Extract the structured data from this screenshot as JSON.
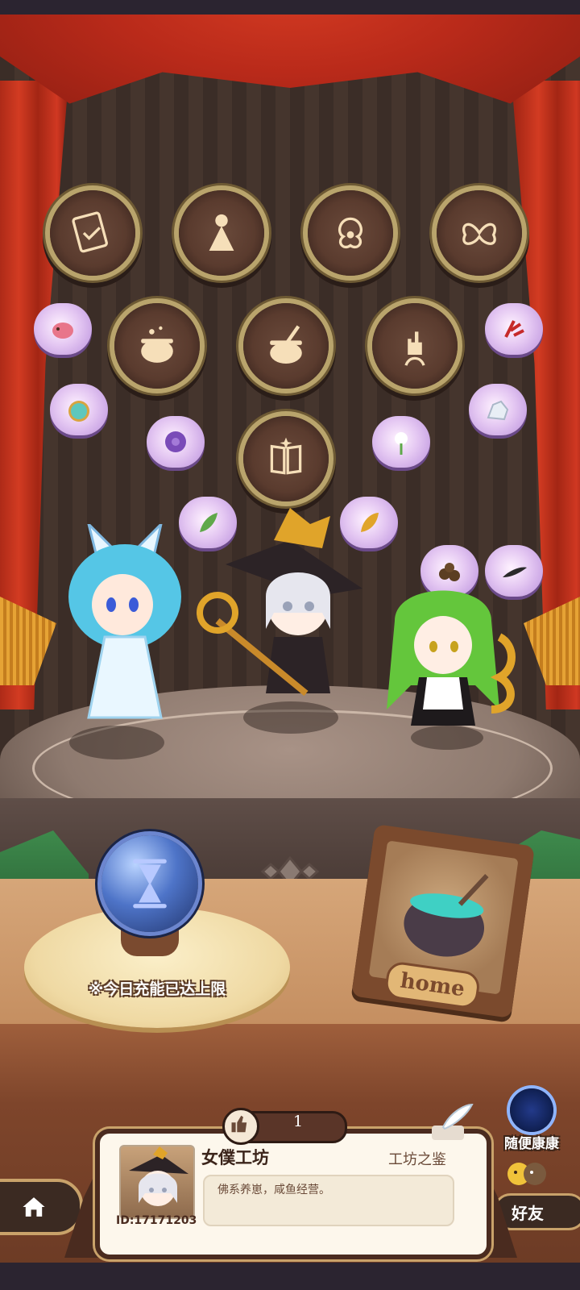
{
  "theme": {
    "curtain": "#c0301d",
    "gold": "#c9a26a",
    "card_bg": "#fdf7ec",
    "bubble": "#d9b8ee"
  },
  "medals": [
    {
      "name": "certificate-medal-icon"
    },
    {
      "name": "girl-silhouette-medal-icon"
    },
    {
      "name": "ornament-medal-icon"
    },
    {
      "name": "butterfly-medal-icon"
    },
    {
      "name": "cauldron-medal-icon"
    },
    {
      "name": "cauldron-stir-medal-icon"
    },
    {
      "name": "hand-sprout-medal-icon"
    },
    {
      "name": "book-medal-icon"
    }
  ],
  "bubbles": [
    {
      "name": "larva-bubble-icon"
    },
    {
      "name": "pocket-watch-bubble-icon"
    },
    {
      "name": "purple-flower-bubble-icon"
    },
    {
      "name": "green-leaf-bubble-icon"
    },
    {
      "name": "gold-leaf-bubble-icon"
    },
    {
      "name": "white-flower-bubble-icon"
    },
    {
      "name": "crystal-bubble-icon"
    },
    {
      "name": "red-coral-bubble-icon"
    },
    {
      "name": "mushroom-bubble-icon"
    },
    {
      "name": "feather-bubble-icon"
    }
  ],
  "recharge": {
    "icon": "hourglass-icon",
    "status": "※今日充能已达上限"
  },
  "home_frame": {
    "label": "home"
  },
  "side_actions": {
    "random_visit": "随便康康",
    "friends": "好友"
  },
  "likes": {
    "count": "1"
  },
  "profile": {
    "shop_name": "女僕工坊",
    "tag": "工坊之鉴",
    "motto": "佛系养崽，咸鱼经营。",
    "player_id": "ID:17171203"
  }
}
